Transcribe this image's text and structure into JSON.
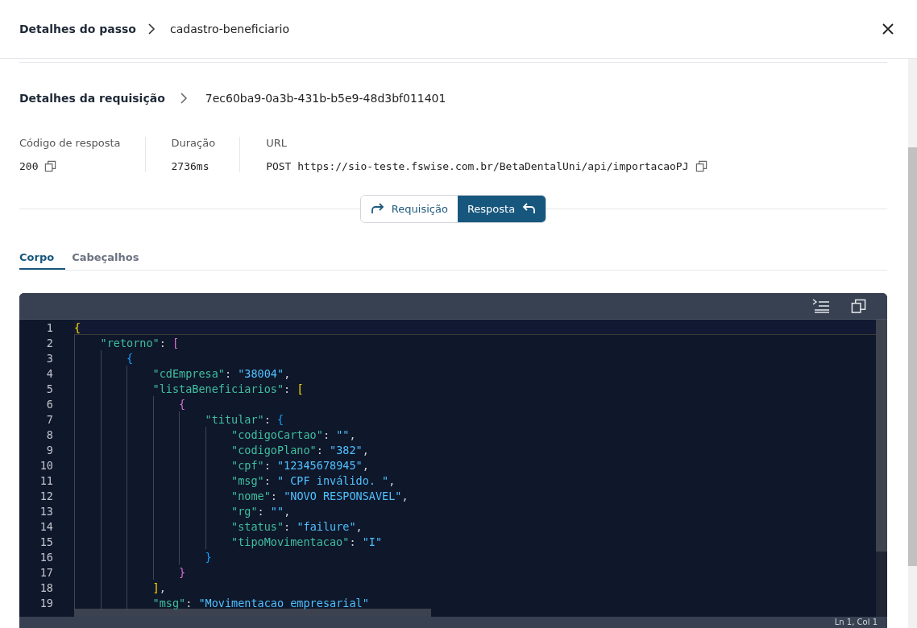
{
  "header": {
    "title": "Detalhes do passo",
    "step": "cadastro-beneficiario"
  },
  "request": {
    "title": "Detalhes da requisição",
    "id": "7ec60ba9-0a3b-431b-b5e9-48d3bf011401"
  },
  "stats": [
    {
      "label": "Código de resposta",
      "value": "200",
      "copyable": true
    },
    {
      "label": "Duração",
      "value": "2736ms",
      "copyable": false
    },
    {
      "label": "URL",
      "value": "POST https://sio-teste.fswise.com.br/BetaDentalUni/api/importacaoPJ",
      "copyable": true
    }
  ],
  "toggle": [
    {
      "label": "Requisição",
      "selected": false
    },
    {
      "label": "Resposta",
      "selected": true
    }
  ],
  "tabs": [
    {
      "label": "Corpo",
      "selected": true
    },
    {
      "label": "Cabeçalhos",
      "selected": false
    }
  ],
  "editor": {
    "status": "Ln 1, Col 1",
    "lines": [
      {
        "n": "1",
        "code": "{"
      },
      {
        "n": "2",
        "code": "    \"retorno\": ["
      },
      {
        "n": "3",
        "code": "        {"
      },
      {
        "n": "4",
        "code": "            \"cdEmpresa\": \"38004\","
      },
      {
        "n": "5",
        "code": "            \"listaBeneficiarios\": ["
      },
      {
        "n": "6",
        "code": "                {"
      },
      {
        "n": "7",
        "code": "                    \"titular\": {"
      },
      {
        "n": "8",
        "code": "                        \"codigoCartao\": \"\","
      },
      {
        "n": "9",
        "code": "                        \"codigoPlano\": \"382\","
      },
      {
        "n": "10",
        "code": "                        \"cpf\": \"12345678945\","
      },
      {
        "n": "11",
        "code": "                        \"msg\": \" CPF inválido. \","
      },
      {
        "n": "12",
        "code": "                        \"nome\": \"NOVO RESPONSAVEL\","
      },
      {
        "n": "13",
        "code": "                        \"rg\": \"\","
      },
      {
        "n": "14",
        "code": "                        \"status\": \"failure\","
      },
      {
        "n": "15",
        "code": "                        \"tipoMovimentacao\": \"I\""
      },
      {
        "n": "16",
        "code": "                    }"
      },
      {
        "n": "17",
        "code": "                }"
      },
      {
        "n": "18",
        "code": "            ],"
      },
      {
        "n": "19",
        "code": "            \"msg\": \"Movimentacao empresarial\""
      }
    ]
  }
}
